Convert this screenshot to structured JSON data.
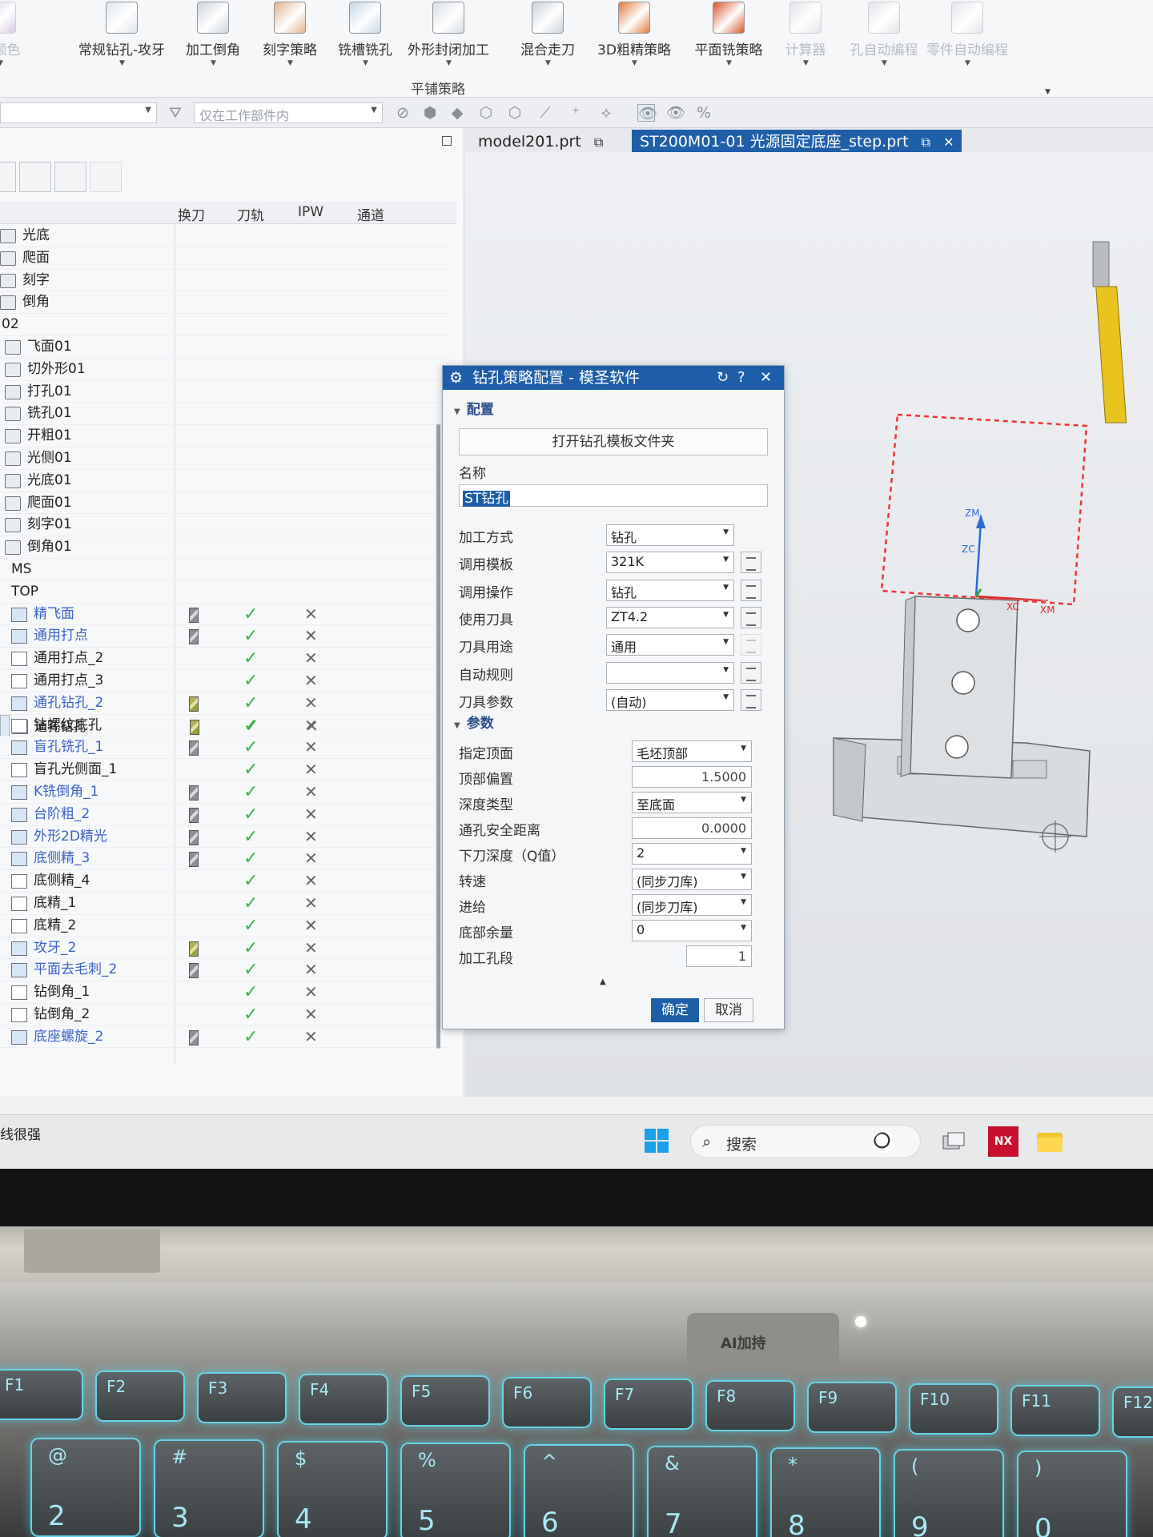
{
  "ribbon": {
    "buttons": [
      {
        "label": "孔颜色",
        "icon": "hole-color-icon",
        "dim": true
      },
      {
        "label": "常规钻孔-攻牙",
        "icon": "drill-tap-icon"
      },
      {
        "label": "加工倒角",
        "icon": "chamfer-icon"
      },
      {
        "label": "刻字策略",
        "icon": "engrave-icon"
      },
      {
        "label": "铣槽铣孔",
        "icon": "slot-mill-icon"
      },
      {
        "label": "外形封闭加工",
        "icon": "contour-icon"
      },
      {
        "label": "混合走刀",
        "icon": "mixed-path-icon"
      },
      {
        "label": "3D粗精策略",
        "icon": "3d-rough-finish-icon"
      },
      {
        "label": "平面铣策略",
        "icon": "face-mill-icon"
      },
      {
        "label": "计算器",
        "icon": "calculator-icon",
        "dim": true
      },
      {
        "label": "孔自动编程",
        "icon": "hole-auto-program-icon",
        "dim": true
      },
      {
        "label": "零件自动编程",
        "icon": "part-auto-program-icon",
        "dim": true
      }
    ],
    "group_label": "平铺策略"
  },
  "toolbar2": {
    "filter_value": "仅在工作部件内"
  },
  "navigator": {
    "columns": [
      "换刀",
      "刀轨",
      "IPW",
      "通道"
    ],
    "rows": [
      {
        "label": "光底",
        "kind": "folder",
        "indent": 0
      },
      {
        "label": "爬面",
        "kind": "folder",
        "indent": 0
      },
      {
        "label": "刻字",
        "kind": "folder",
        "indent": 0
      },
      {
        "label": "倒角",
        "kind": "folder",
        "indent": 0
      },
      {
        "label": "02",
        "kind": "text",
        "indent": -1
      },
      {
        "label": "飞面01",
        "kind": "folder",
        "indent": 1
      },
      {
        "label": "切外形01",
        "kind": "folder",
        "indent": 1
      },
      {
        "label": "打孔01",
        "kind": "folder",
        "indent": 1
      },
      {
        "label": "铣孔01",
        "kind": "folder",
        "indent": 1
      },
      {
        "label": "开粗01",
        "kind": "folder",
        "indent": 1
      },
      {
        "label": "光侧01",
        "kind": "folder",
        "indent": 1
      },
      {
        "label": "光底01",
        "kind": "folder",
        "indent": 1
      },
      {
        "label": "爬面01",
        "kind": "folder",
        "indent": 1
      },
      {
        "label": "刻字01",
        "kind": "folder",
        "indent": 1
      },
      {
        "label": "倒角01",
        "kind": "folder",
        "indent": 1
      },
      {
        "label": "MS",
        "kind": "ms",
        "indent": -1
      },
      {
        "label": "TOP",
        "kind": "ms",
        "indent": -1
      },
      {
        "label": "精飞面",
        "kind": "op",
        "blue": true,
        "tool": "g",
        "check": true,
        "x": true,
        "indent": 2
      },
      {
        "label": "通用打点",
        "kind": "op",
        "blue": true,
        "tool": "g",
        "check": true,
        "x": true,
        "indent": 2
      },
      {
        "label": "通用打点_2",
        "kind": "op",
        "tool": "",
        "check": true,
        "x": true,
        "indent": 2
      },
      {
        "label": "通用打点_3",
        "kind": "op",
        "tool": "",
        "check": true,
        "x": true,
        "indent": 2
      },
      {
        "label": "通孔钻孔_2",
        "kind": "op",
        "blue": true,
        "tool": "y",
        "check": true,
        "x": true,
        "indent": 2
      },
      {
        "label": "通孔钻孔",
        "kind": "op",
        "tool": "y",
        "check": true,
        "x": true,
        "indent": 2,
        "selected": true
      },
      {
        "label": "钻螺纹底孔",
        "kind": "op",
        "tool": "",
        "check": true,
        "x": true,
        "indent": 2
      },
      {
        "label": "盲孔铣孔_1",
        "kind": "op",
        "blue": true,
        "tool": "g",
        "check": true,
        "x": true,
        "indent": 2
      },
      {
        "label": "盲孔光侧面_1",
        "kind": "op",
        "tool": "",
        "check": true,
        "x": true,
        "indent": 2
      },
      {
        "label": "K铣倒角_1",
        "kind": "op",
        "blue": true,
        "tool": "g",
        "check": true,
        "x": true,
        "indent": 2
      },
      {
        "label": "台阶粗_2",
        "kind": "op",
        "blue": true,
        "tool": "g",
        "check": true,
        "x": true,
        "indent": 2
      },
      {
        "label": "外形2D精光",
        "kind": "op",
        "blue": true,
        "tool": "g",
        "check": true,
        "x": true,
        "indent": 2
      },
      {
        "label": "底侧精_3",
        "kind": "op",
        "blue": true,
        "tool": "g",
        "check": true,
        "x": true,
        "indent": 2
      },
      {
        "label": "底侧精_4",
        "kind": "op",
        "tool": "",
        "check": true,
        "x": true,
        "indent": 2
      },
      {
        "label": "底精_1",
        "kind": "op",
        "tool": "",
        "check": true,
        "x": true,
        "indent": 2
      },
      {
        "label": "底精_2",
        "kind": "op",
        "tool": "",
        "check": true,
        "x": true,
        "indent": 2
      },
      {
        "label": "攻牙_2",
        "kind": "op",
        "blue": true,
        "tool": "y",
        "check": true,
        "x": true,
        "indent": 2
      },
      {
        "label": "平面去毛刺_2",
        "kind": "op",
        "blue": true,
        "tool": "g",
        "check": true,
        "x": true,
        "indent": 2
      },
      {
        "label": "钻倒角_1",
        "kind": "op",
        "tool": "",
        "check": true,
        "x": true,
        "indent": 2
      },
      {
        "label": "钻倒角_2",
        "kind": "op",
        "tool": "",
        "check": true,
        "x": true,
        "indent": 2
      },
      {
        "label": "底座螺旋_2",
        "kind": "op",
        "blue": true,
        "tool": "g",
        "check": true,
        "x": true,
        "indent": 2
      }
    ]
  },
  "tabs": [
    {
      "label": "model201.prt",
      "active": false
    },
    {
      "label": "ST200M01-01 光源固定底座_step.prt",
      "active": true
    }
  ],
  "viewport": {
    "axis_labels": {
      "zm": "ZM",
      "zc": "ZC",
      "xc": "XC",
      "xm": "XM"
    }
  },
  "dialog": {
    "title": "钻孔策略配置 - 模圣软件",
    "section_config": "配置",
    "open_folder_button": "打开钻孔模板文件夹",
    "name_label": "名称",
    "name_value": "ST钻孔",
    "config_fields": [
      {
        "label": "加工方式",
        "value": "钻孔",
        "has_button": false
      },
      {
        "label": "调用模板",
        "value": "321K",
        "has_button": true
      },
      {
        "label": "调用操作",
        "value": "钻孔",
        "has_button": true
      },
      {
        "label": "使用刀具",
        "value": "ZT4.2",
        "has_button": true
      },
      {
        "label": "刀具用途",
        "value": "通用",
        "has_button": true,
        "disabled": true
      },
      {
        "label": "自动规则",
        "value": "",
        "has_button": true
      },
      {
        "label": "刀具参数",
        "value": "(自动)",
        "has_button": true
      }
    ],
    "section_params": "参数",
    "param_fields": [
      {
        "label": "指定顶面",
        "value": "毛坯顶部",
        "type": "select"
      },
      {
        "label": "顶部偏置",
        "value": "1.5000",
        "type": "number"
      },
      {
        "label": "深度类型",
        "value": "至底面",
        "type": "select"
      },
      {
        "label": "通孔安全距离",
        "value": "0.0000",
        "type": "number"
      },
      {
        "label": "下刀深度（Q值）",
        "value": "2",
        "type": "select"
      },
      {
        "label": "转速",
        "value": "(同步刀库)",
        "type": "select"
      },
      {
        "label": "进给",
        "value": "(同步刀库)",
        "type": "select"
      },
      {
        "label": "底部余量",
        "value": "0",
        "type": "select"
      },
      {
        "label": "加工孔段",
        "value": "1",
        "type": "number"
      }
    ],
    "ok_label": "确定",
    "cancel_label": "取消"
  },
  "taskbar": {
    "left_text": "线很强",
    "search_placeholder": "搜索",
    "nx_label": "NX"
  },
  "laptop": {
    "badge_text": "AI加持",
    "fn_keys": [
      {
        "label": "F1"
      },
      {
        "label": "F2"
      },
      {
        "label": "F3"
      },
      {
        "label": "F4"
      },
      {
        "label": "F5"
      },
      {
        "label": "F6"
      },
      {
        "label": "F7"
      },
      {
        "label": "F8"
      },
      {
        "label": "F9"
      },
      {
        "label": "F10"
      },
      {
        "label": "F11"
      },
      {
        "label": "F12"
      }
    ],
    "num_keys": [
      {
        "sym": "@",
        "num": "2"
      },
      {
        "sym": "#",
        "num": "3"
      },
      {
        "sym": "$",
        "num": "4"
      },
      {
        "sym": "%",
        "num": "5"
      },
      {
        "sym": "^",
        "num": "6"
      },
      {
        "sym": "&",
        "num": "7"
      },
      {
        "sym": "*",
        "num": "8"
      },
      {
        "sym": "(",
        "num": "9"
      },
      {
        "sym": ")",
        "num": "0"
      }
    ]
  }
}
